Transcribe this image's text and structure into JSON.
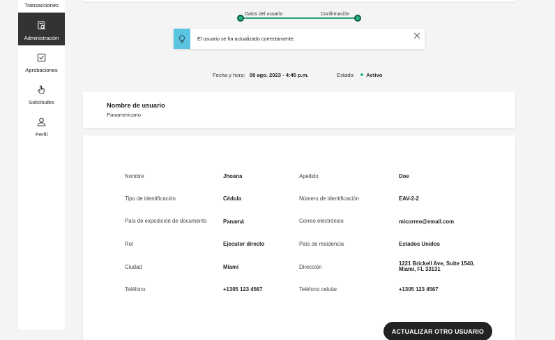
{
  "sidebar": {
    "items": [
      {
        "label": "Transacciones",
        "icon": "transactions-icon",
        "active": false
      },
      {
        "label": "Administración",
        "icon": "search-document-icon",
        "active": true
      },
      {
        "label": "Aprobaciones",
        "icon": "checkbox-icon",
        "active": false
      },
      {
        "label": "Solicitudes",
        "icon": "hand-pointer-icon",
        "active": false
      },
      {
        "label": "Perfil",
        "icon": "user-icon",
        "active": false
      }
    ]
  },
  "stepper": {
    "steps": [
      {
        "label": "Datos del usuario"
      },
      {
        "label": "Confirmación"
      }
    ],
    "color": "#23b87f"
  },
  "alert": {
    "message": "El usuario se ha actualizado correctamente.",
    "accent": "#5bc4e0"
  },
  "meta": {
    "date_label": "Fecha y hora:",
    "date_value": "08 ago. 2023 - 4:45 p.m.",
    "status_label": "Estado:",
    "status_value": "Activo"
  },
  "user_card": {
    "title": "Nombre de usuario",
    "value": "Panamericano"
  },
  "details": {
    "fields": [
      {
        "label": "Nombre",
        "value": "Jhoana"
      },
      {
        "label": "Apellido",
        "value": "Doe"
      },
      {
        "label": "Tipo de identificación",
        "value": "Cédula"
      },
      {
        "label": "Número de identificación",
        "value": "EAV-2-2"
      },
      {
        "label": "País de expedición de documento",
        "value": "Panamá"
      },
      {
        "label": "Correo electrónico",
        "value": "micorreo@email.com"
      },
      {
        "label": "Rol",
        "value": "Ejecutor directo"
      },
      {
        "label": "País de residencia",
        "value": "Estados Unidos"
      },
      {
        "label": "Ciudad",
        "value": "Miami"
      },
      {
        "label": "Dirección",
        "value_line1": "1221 Brickell Ave, Suite 1540,",
        "value_line2": "Miami, FL 33131"
      },
      {
        "label": "Teléfono",
        "value": "+1305 123 4567"
      },
      {
        "label": "Teléfono celular",
        "value": "+1305 123 4567"
      }
    ]
  },
  "actions": {
    "update_another": "ACTUALIZAR OTRO USUARIO"
  }
}
